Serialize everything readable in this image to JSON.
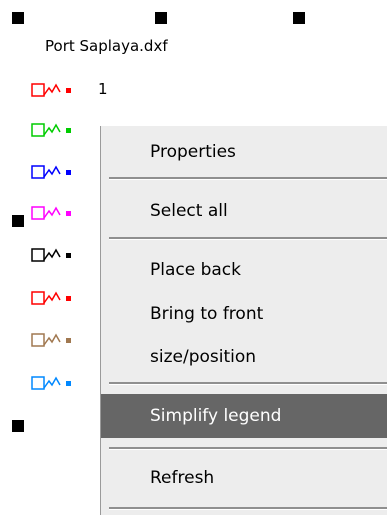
{
  "canvas": {
    "legend": {
      "title": "Port Saplaya.dxf",
      "entries": [
        {
          "label": "1",
          "color": "#ff0000"
        },
        {
          "label": "",
          "color": "#00cc00"
        },
        {
          "label": "",
          "color": "#0000ff"
        },
        {
          "label": "",
          "color": "#ff00ff"
        },
        {
          "label": "",
          "color": "#000000"
        },
        {
          "label": "",
          "color": "#ff0000"
        },
        {
          "label": "",
          "color": "#a07850"
        },
        {
          "label": "",
          "color": "#0088ff"
        }
      ],
      "shape_color": "#ff0000",
      "icon_name": "legend-symbol-icon"
    },
    "selection_handles_icon": "selection-handle-icon"
  },
  "context_menu": {
    "items": [
      {
        "label": "Properties"
      },
      {
        "label": "Select all"
      },
      {
        "label": "Place back"
      },
      {
        "label": "Bring to front"
      },
      {
        "label": "size/position"
      },
      {
        "label": "Simplify legend",
        "highlighted": true
      },
      {
        "label": "Refresh"
      }
    ],
    "highlight_color": "#666666"
  }
}
